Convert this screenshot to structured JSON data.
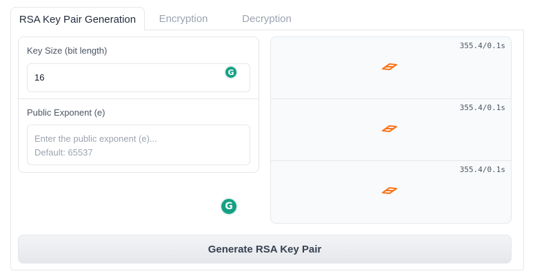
{
  "tabs": [
    {
      "label": "RSA Key Pair Generation"
    },
    {
      "label": "Encryption"
    },
    {
      "label": "Decryption"
    }
  ],
  "form": {
    "key_size_label": "Key Size (bit length)",
    "key_size_value": "16",
    "exponent_label": "Public Exponent (e)",
    "exponent_placeholder_line1": "Enter the public exponent (e)...",
    "exponent_placeholder_line2": "Default: 65537"
  },
  "outputs": [
    {
      "timer": "355.4/0.1s"
    },
    {
      "timer": "355.4/0.1s"
    },
    {
      "timer": "355.4/0.1s"
    }
  ],
  "button": {
    "label": "Generate RSA Key Pair"
  },
  "icons": {
    "grammar": "grammarly-icon",
    "loader": "loading-icon"
  },
  "colors": {
    "accent": "#15a085",
    "loader": "#f97316"
  }
}
